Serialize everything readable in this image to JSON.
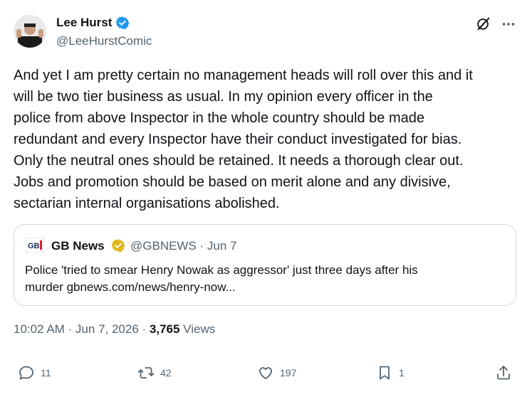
{
  "author": {
    "name": "Lee Hurst",
    "handle": "@LeeHurstComic"
  },
  "tweet": {
    "lines": [
      "And yet I am pretty certain no management heads will roll over this and it",
      "will be two tier business as usual. In my opinion every officer in the",
      "police from above Inspector in the whole country should be made",
      "redundant and every Inspector have their conduct investigated for bias.",
      "Only the neutral ones should be retained. It needs a thorough clear out.",
      "Jobs and promotion should be based on merit alone and any divisive,",
      "sectarian internal organisations abolished."
    ]
  },
  "quote": {
    "logo_text": "GB News",
    "name": "GB News",
    "handle_date": "@GBNEWS · Jun 7",
    "text_line1": "Police 'tried to smear Henry Nowak as aggressor' just three days after his",
    "text_line2": "murder  gbnews.com/news/henry-now..."
  },
  "meta": {
    "time_date": "10:02 AM · Jun 7, 2026 · ",
    "views_count": "3,765",
    "views_label": " Views"
  },
  "actions": {
    "replies": "11",
    "reposts": "42",
    "likes": "197",
    "bookmarks": "1"
  },
  "colors": {
    "verified_blue": "#1d9bf0",
    "verified_gold": "#e2b719",
    "text": "#0f1419",
    "secondary": "#536471"
  },
  "icons": [
    "verified-badge-icon",
    "grok-icon",
    "more-icon",
    "reply-icon",
    "repost-icon",
    "like-icon",
    "bookmark-icon",
    "share-icon"
  ]
}
